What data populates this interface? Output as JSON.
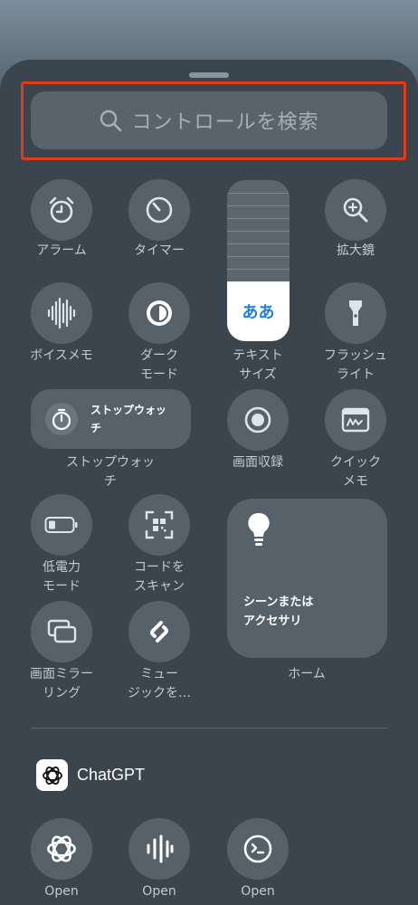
{
  "search": {
    "placeholder": "コントロールを検索"
  },
  "controls": {
    "alarm": "アラーム",
    "timer": "タイマー",
    "magnifier": "拡大鏡",
    "voice_memo": "ボイスメモ",
    "dark_mode_1": "ダーク",
    "dark_mode_2": "モード",
    "text_size_1": "テキスト",
    "text_size_2": "サイズ",
    "text_size_sample": "ああ",
    "flashlight_1": "フラッシュ",
    "flashlight_2": "ライト",
    "stopwatch_tile_1": "ストップウォッ",
    "stopwatch_tile_2": "チ",
    "stopwatch": "ストップウォッチ",
    "screen_record": "画面収録",
    "quick_note_1": "クイック",
    "quick_note_2": "メモ",
    "low_power_1": "低電力",
    "low_power_2": "モード",
    "scan_code_1": "コードを",
    "scan_code_2": "スキャン",
    "home_tile_1": "シーンまたは",
    "home_tile_2": "アクセサリ",
    "home": "ホーム",
    "screen_mirror_1": "画面ミラー",
    "screen_mirror_2": "リング",
    "shazam_1": "ミュー",
    "shazam_2": "ジックを…"
  },
  "app_section": {
    "name": "ChatGPT",
    "buttons": [
      {
        "label": "Open"
      },
      {
        "label": "Open"
      },
      {
        "label": "Open"
      }
    ]
  },
  "colors": {
    "highlight": "#e23a1a",
    "accent": "#1d7fdc"
  }
}
